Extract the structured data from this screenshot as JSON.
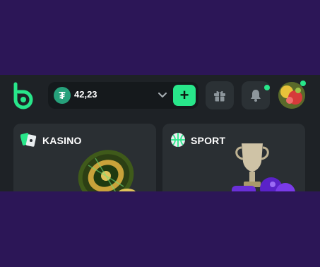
{
  "header": {
    "logo": {
      "icon": "brand-logo-icon",
      "color": "#28e68a"
    },
    "wallet": {
      "currency_icon": "tether-icon",
      "currency_symbol": "₮",
      "balance": "42,23",
      "dropdown_icon": "chevron-down-icon",
      "deposit_symbol": "+"
    },
    "gift_button": {
      "icon": "gift-icon"
    },
    "notifications_button": {
      "icon": "bell-icon",
      "has_indicator": true
    },
    "profile": {
      "icon": "avatar",
      "has_indicator": true
    }
  },
  "cards": [
    {
      "title": "KASINO",
      "icon": "cards-icon",
      "art": "roulette-wheel-illustration"
    },
    {
      "title": "SPORT",
      "icon": "basketball-icon",
      "art": "trophy-illustration"
    }
  ],
  "colors": {
    "page_background": "#2c1657",
    "app_background": "#1e2226",
    "accent": "#28e68a",
    "card_background": "#2a2f33"
  }
}
